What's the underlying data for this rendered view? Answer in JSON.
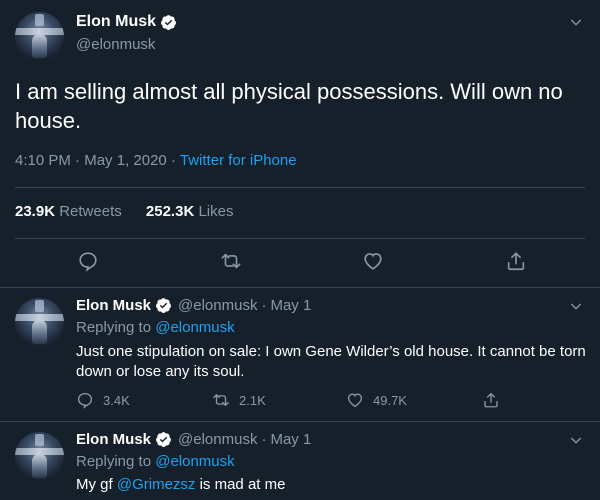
{
  "main_tweet": {
    "author_name": "Elon Musk",
    "author_handle": "@elonmusk",
    "text": "I am selling almost all physical possessions. Will own no house.",
    "time": "4:10 PM",
    "date": "May 1, 2020",
    "source": "Twitter for iPhone",
    "retweets_count": "23.9K",
    "retweets_label": "Retweets",
    "likes_count": "252.3K",
    "likes_label": "Likes"
  },
  "replies": [
    {
      "author_name": "Elon Musk",
      "author_handle": "@elonmusk",
      "date": "May 1",
      "replying_label": "Replying to",
      "replying_to": "@elonmusk",
      "text": "Just one stipulation on sale: I own Gene Wilder’s old house. It cannot be torn down or lose any its soul.",
      "reply_count": "3.4K",
      "retweet_count": "2.1K",
      "like_count": "49.7K"
    },
    {
      "author_name": "Elon Musk",
      "author_handle": "@elonmusk",
      "date": "May 1",
      "replying_label": "Replying to",
      "replying_to": "@elonmusk",
      "text_before": "My gf",
      "text_mention": "@Grimezsz",
      "text_after": "is mad at me"
    }
  ],
  "ui": {
    "separator_dot": "·",
    "icons": [
      "chevron-down-icon",
      "verified-badge-icon",
      "reply-icon",
      "retweet-icon",
      "like-icon",
      "share-icon"
    ],
    "colors": {
      "background": "#15202b",
      "text": "#ffffff",
      "secondary_text": "#8899a6",
      "accent": "#1da1f2",
      "divider": "#38444d"
    }
  }
}
